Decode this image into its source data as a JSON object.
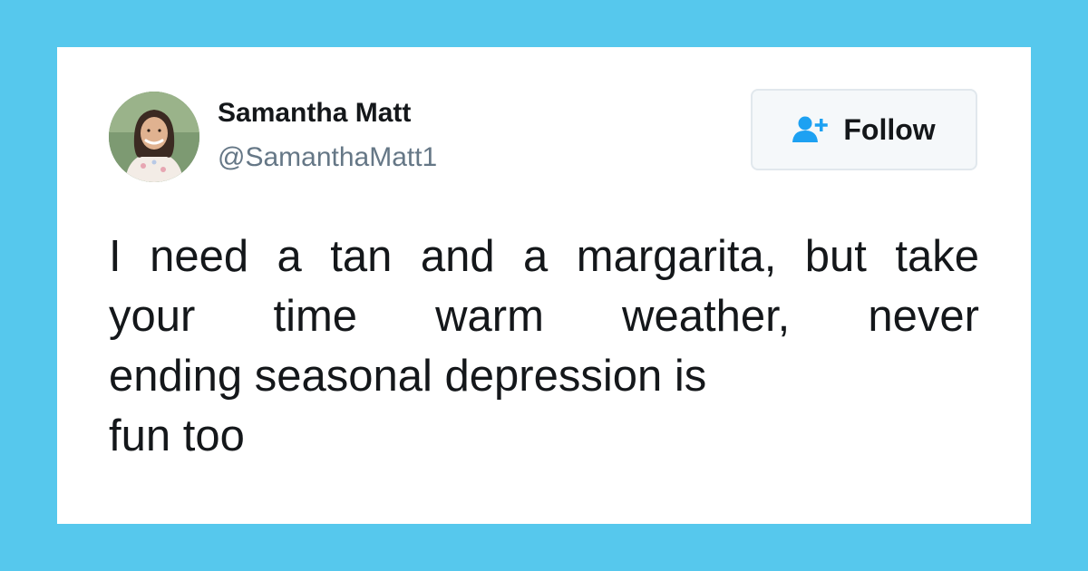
{
  "colors": {
    "page_background": "#56c8ed",
    "card_background": "#ffffff",
    "name_text": "#14171a",
    "handle_text": "#657786",
    "follow_icon": "#1da1f2",
    "follow_border": "#e1e8ed"
  },
  "user": {
    "display_name": "Samantha Matt",
    "handle": "@SamanthaMatt1",
    "avatar_icon": "profile-photo"
  },
  "follow_button": {
    "icon": "add-user-icon",
    "label": "Follow"
  },
  "tweet": {
    "lines": [
      "I need a tan and a margarita, but take",
      "your time warm weather, never",
      "ending seasonal depression is",
      "fun too"
    ]
  }
}
